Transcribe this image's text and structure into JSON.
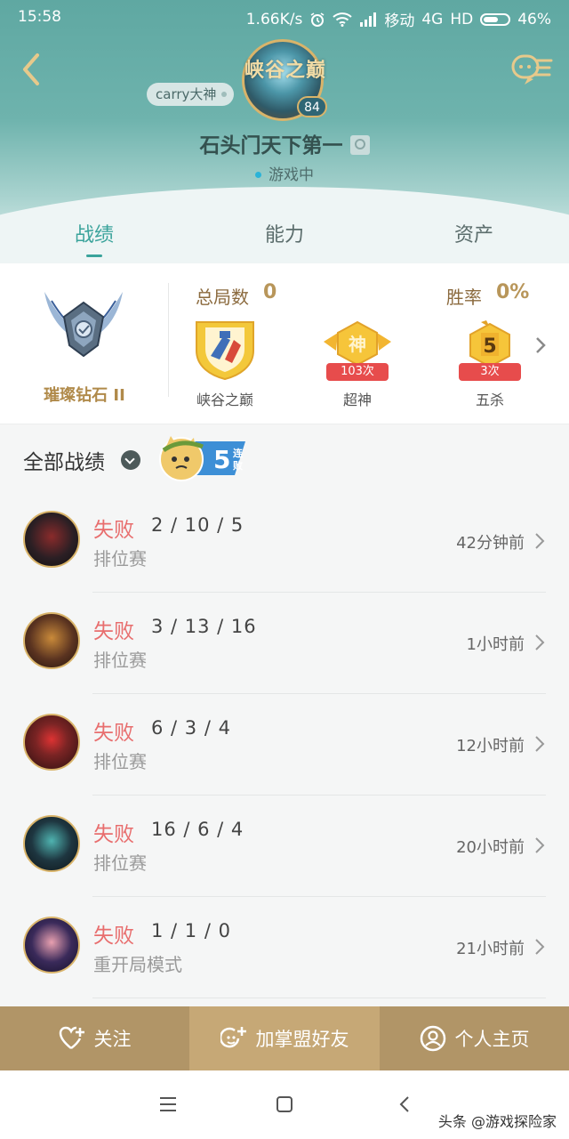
{
  "status_bar": {
    "time": "15:58",
    "net_speed": "1.66K/s",
    "carrier": "移动",
    "network": "4G",
    "hd": "HD",
    "battery": "46%"
  },
  "profile": {
    "crest_title": "峡谷之巅",
    "level": "84",
    "tag": "carry大神",
    "username": "石头门天下第一",
    "status": "游戏中"
  },
  "tabs": [
    {
      "label": "战绩"
    },
    {
      "label": "能力"
    },
    {
      "label": "资产"
    }
  ],
  "stats": {
    "rank_name": "璀璨钻石 II",
    "total_label": "总局数",
    "total_value": "0",
    "winrate_label": "胜率",
    "winrate_value": "0%",
    "achievements": [
      {
        "label": "峡谷之巅",
        "count": ""
      },
      {
        "label": "超神",
        "count": "103次",
        "glyph": "神"
      },
      {
        "label": "五杀",
        "count": "3次",
        "glyph": "5"
      }
    ]
  },
  "records": {
    "title": "全部战绩",
    "streak_number": "5",
    "streak_text": "连败",
    "items": [
      {
        "result": "失败",
        "kda": "2 / 10 / 5",
        "mode": "排位赛",
        "time": "42分钟前",
        "color": "#2b1f24"
      },
      {
        "result": "失败",
        "kda": "3 / 13 / 16",
        "mode": "排位赛",
        "time": "1小时前",
        "color": "#5a3320"
      },
      {
        "result": "失败",
        "kda": "6 / 3 / 4",
        "mode": "排位赛",
        "time": "12小时前",
        "color": "#7a2424"
      },
      {
        "result": "失败",
        "kda": "16 / 6 / 4",
        "mode": "排位赛",
        "time": "20小时前",
        "color": "#1e3640"
      },
      {
        "result": "失败",
        "kda": "1 / 1 / 0",
        "mode": "重开局模式",
        "time": "21小时前",
        "color": "#3a2a5a"
      }
    ]
  },
  "actions": {
    "follow": "关注",
    "add_friend": "加掌盟好友",
    "homepage": "个人主页"
  },
  "watermark": "头条 @游戏探险家",
  "colors": {
    "accent": "#3aa39b",
    "loss": "#e86e6e",
    "gold": "#b8965a"
  }
}
